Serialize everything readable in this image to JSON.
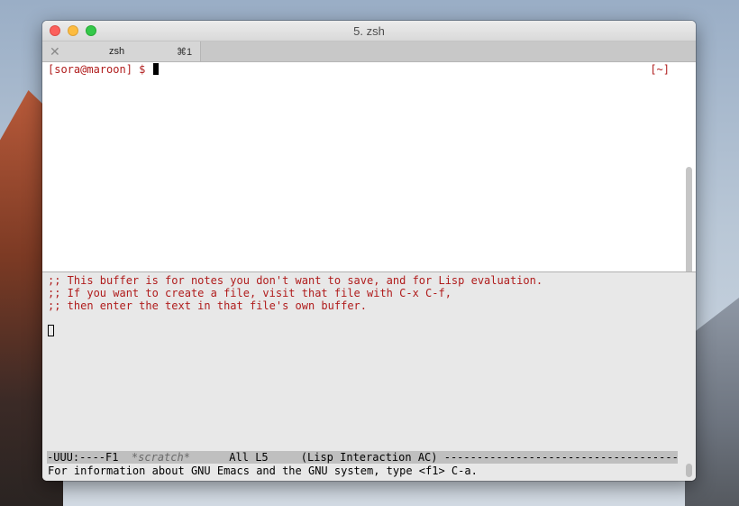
{
  "window": {
    "title": "5. zsh"
  },
  "tabs": [
    {
      "label": "zsh",
      "shortcut": "⌘1",
      "close_glyph": "✕"
    }
  ],
  "terminal": {
    "prompt": "[sora@maroon] $ ",
    "right_prompt": "[~]"
  },
  "emacs": {
    "scratch_lines": [
      ";; This buffer is for notes you don't want to save, and for Lisp evaluation.",
      ";; If you want to create a file, visit that file with C-x C-f,",
      ";; then enter the text in that file's own buffer."
    ],
    "modeline": {
      "prefix": "-UUU:----F1  ",
      "buffer_name": "*scratch*",
      "position": "      All L5     ",
      "mode": "(Lisp Interaction AC) ",
      "fill": "------------------------------------------------------------------------"
    },
    "echo_area": "For information about GNU Emacs and the GNU system, type <f1> C-a."
  },
  "colors": {
    "prompt_red": "#b01c1c",
    "emacs_background": "#e8e8e8",
    "modeline_background": "#bfbfbf"
  }
}
